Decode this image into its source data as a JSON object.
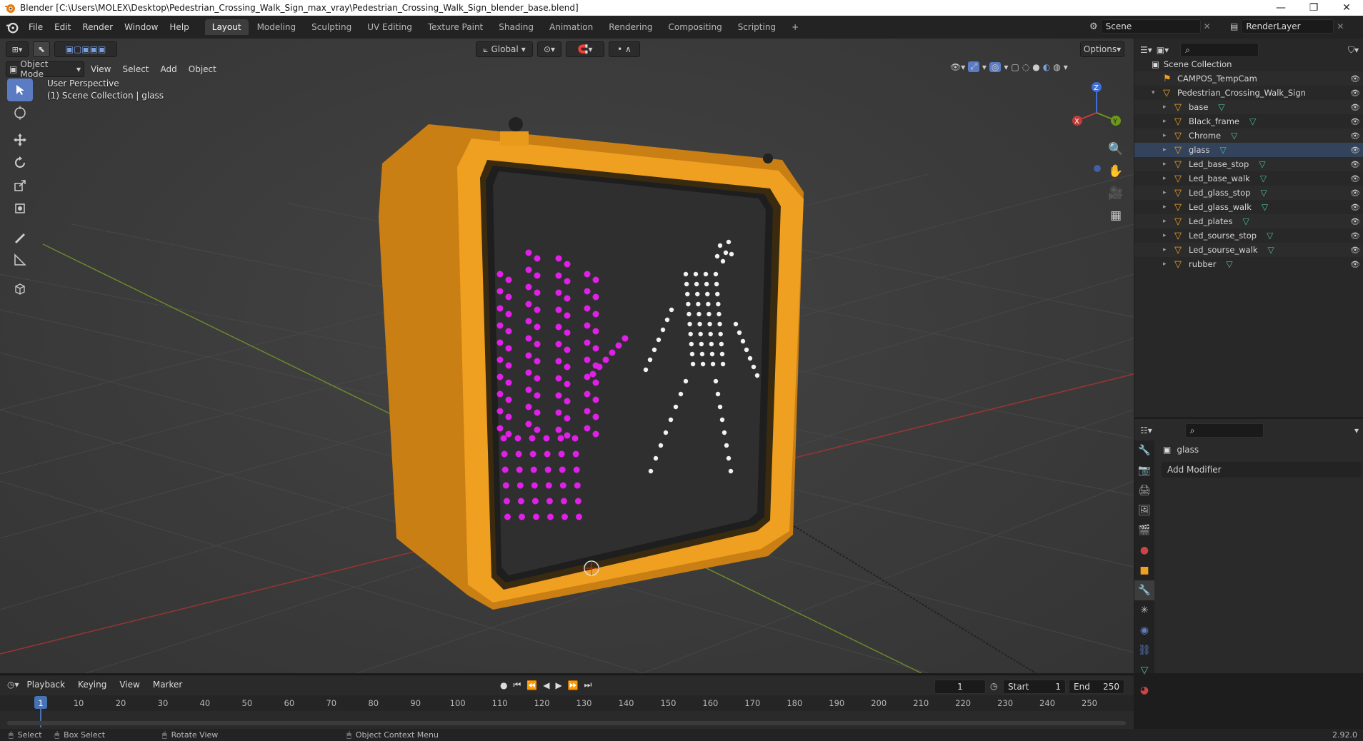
{
  "titlebar": {
    "title": "Blender [C:\\Users\\MOLEX\\Desktop\\Pedestrian_Crossing_Walk_Sign_max_vray\\Pedestrian_Crossing_Walk_Sign_blender_base.blend]",
    "minimize": "—",
    "restore": "❐",
    "close": "✕"
  },
  "menus": [
    "File",
    "Edit",
    "Render",
    "Window",
    "Help"
  ],
  "workspaces": [
    "Layout",
    "Modeling",
    "Sculpting",
    "UV Editing",
    "Texture Paint",
    "Shading",
    "Animation",
    "Rendering",
    "Compositing",
    "Scripting"
  ],
  "workspace_add": "+",
  "scene": {
    "name": "Scene",
    "view_layer": "RenderLayer"
  },
  "viewport": {
    "transform_orientation": "Global",
    "options_label": "Options",
    "mode": "Object Mode",
    "header_menus": [
      "View",
      "Select",
      "Add",
      "Object"
    ],
    "view_name": "User Perspective",
    "collection_info": "(1) Scene Collection | glass",
    "gizmo_axes": {
      "x": "X",
      "y": "Y",
      "z": "Z"
    }
  },
  "outliner": {
    "root": "Scene Collection",
    "items": [
      {
        "name": "CAMPOS_TempCam",
        "level": 1,
        "type": "camera"
      },
      {
        "name": "Pedestrian_Crossing_Walk_Sign",
        "level": 1,
        "type": "object"
      },
      {
        "name": "base",
        "level": 2,
        "type": "mesh"
      },
      {
        "name": "Black_frame",
        "level": 2,
        "type": "mesh"
      },
      {
        "name": "Chrome",
        "level": 2,
        "type": "mesh"
      },
      {
        "name": "glass",
        "level": 2,
        "type": "mesh",
        "selected": true
      },
      {
        "name": "Led_base_stop",
        "level": 2,
        "type": "mesh"
      },
      {
        "name": "Led_base_walk",
        "level": 2,
        "type": "mesh"
      },
      {
        "name": "Led_glass_stop",
        "level": 2,
        "type": "mesh"
      },
      {
        "name": "Led_glass_walk",
        "level": 2,
        "type": "mesh"
      },
      {
        "name": "Led_plates",
        "level": 2,
        "type": "mesh"
      },
      {
        "name": "Led_sourse_stop",
        "level": 2,
        "type": "mesh"
      },
      {
        "name": "Led_sourse_walk",
        "level": 2,
        "type": "mesh"
      },
      {
        "name": "rubber",
        "level": 2,
        "type": "mesh"
      }
    ]
  },
  "properties": {
    "object_name": "glass",
    "add_modifier": "Add Modifier"
  },
  "timeline": {
    "menus": [
      "Playback",
      "Keying",
      "View",
      "Marker"
    ],
    "current_frame": "1",
    "start_label": "Start",
    "start": "1",
    "end_label": "End",
    "end": "250",
    "ticks": [
      "1",
      "10",
      "20",
      "30",
      "40",
      "50",
      "60",
      "70",
      "80",
      "90",
      "100",
      "110",
      "120",
      "130",
      "140",
      "150",
      "160",
      "170",
      "180",
      "190",
      "200",
      "210",
      "220",
      "230",
      "240",
      "250"
    ]
  },
  "statusbar": {
    "select": "Select",
    "box_select": "Box Select",
    "rotate_view": "Rotate View",
    "context_menu": "Object Context Menu",
    "version": "2.92.0"
  },
  "colors": {
    "housing": "#f0a020",
    "led_stop": "#e020e8",
    "led_walk": "#f2f2f2",
    "accent": "#5b7bc3",
    "grid_x": "#9a3434",
    "grid_y": "#6a8a2a"
  },
  "icons": {
    "blender_logo": "blender-logo-icon",
    "search": "search-icon",
    "eye": "eye-icon",
    "mesh": "mesh-icon",
    "filter": "filter-icon"
  }
}
